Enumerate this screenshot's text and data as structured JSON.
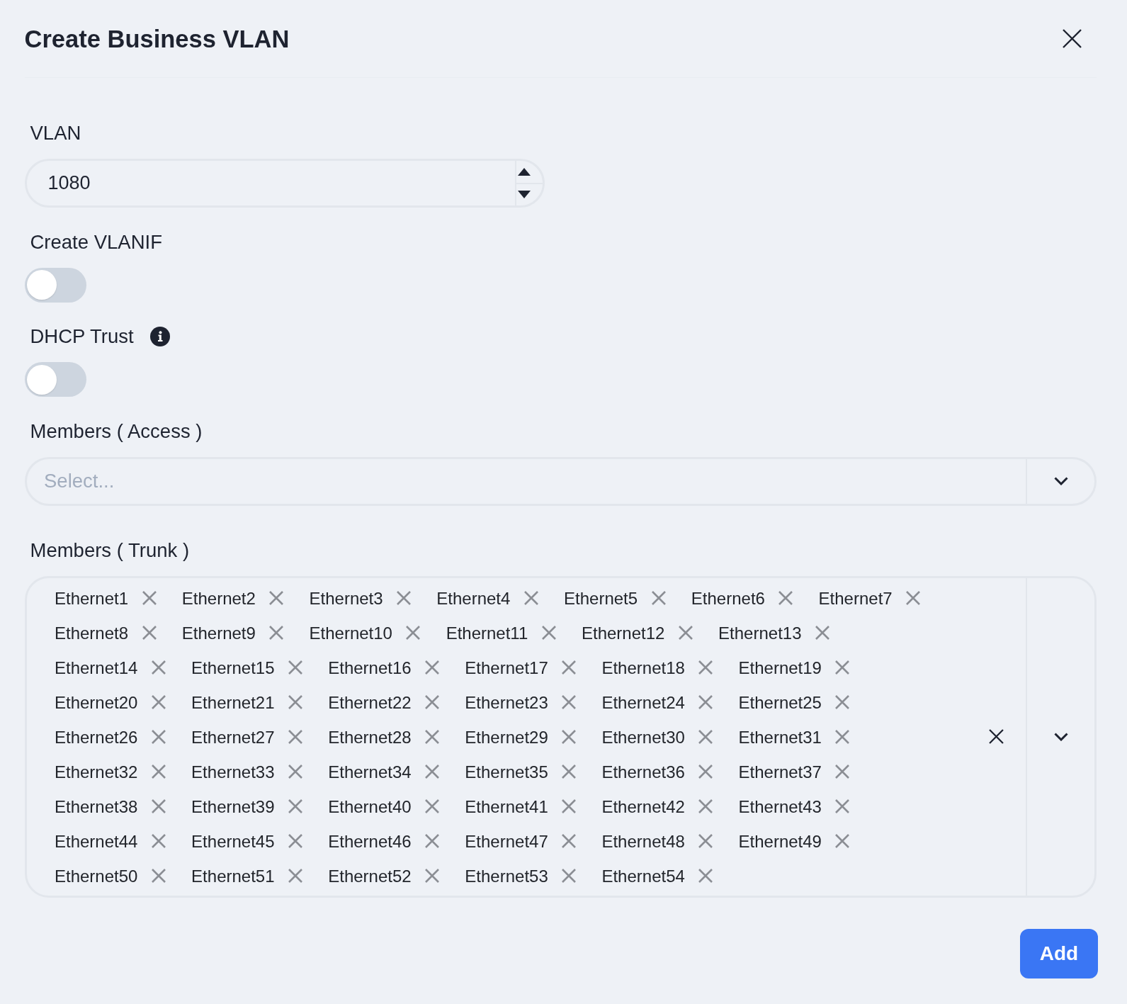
{
  "dialog": {
    "title": "Create Business VLAN"
  },
  "fields": [
    {
      "kind": "number",
      "label": "VLAN",
      "value": "1080"
    },
    {
      "kind": "toggle",
      "label": "Create VLANIF",
      "on": false
    },
    {
      "kind": "toggle",
      "label": "DHCP Trust",
      "on": false,
      "info": true
    },
    {
      "kind": "select",
      "label": "Members ( Access )",
      "placeholder": "Select..."
    },
    {
      "kind": "multiselect",
      "label": "Members ( Trunk )",
      "tags": [
        "Ethernet1",
        "Ethernet2",
        "Ethernet3",
        "Ethernet4",
        "Ethernet5",
        "Ethernet6",
        "Ethernet7",
        "Ethernet8",
        "Ethernet9",
        "Ethernet10",
        "Ethernet11",
        "Ethernet12",
        "Ethernet13",
        "Ethernet14",
        "Ethernet15",
        "Ethernet16",
        "Ethernet17",
        "Ethernet18",
        "Ethernet19",
        "Ethernet20",
        "Ethernet21",
        "Ethernet22",
        "Ethernet23",
        "Ethernet24",
        "Ethernet25",
        "Ethernet26",
        "Ethernet27",
        "Ethernet28",
        "Ethernet29",
        "Ethernet30",
        "Ethernet31",
        "Ethernet32",
        "Ethernet33",
        "Ethernet34",
        "Ethernet35",
        "Ethernet36",
        "Ethernet37",
        "Ethernet38",
        "Ethernet39",
        "Ethernet40",
        "Ethernet41",
        "Ethernet42",
        "Ethernet43",
        "Ethernet44",
        "Ethernet45",
        "Ethernet46",
        "Ethernet47",
        "Ethernet48",
        "Ethernet49",
        "Ethernet50",
        "Ethernet51",
        "Ethernet52",
        "Ethernet53",
        "Ethernet54"
      ]
    }
  ],
  "buttons": [
    {
      "label": "Add"
    }
  ]
}
